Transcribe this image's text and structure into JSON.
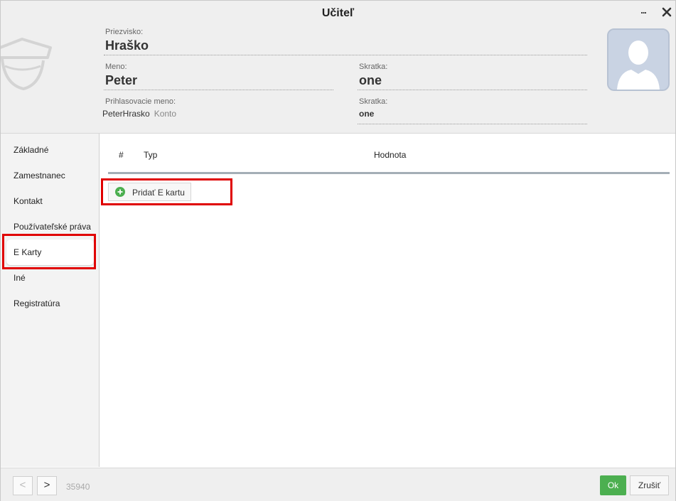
{
  "window": {
    "title": "Učiteľ",
    "more_label": "...",
    "close_label": "Close"
  },
  "header": {
    "surname_label": "Priezvisko:",
    "surname": "Hraško",
    "first_name_label": "Meno:",
    "first_name": "Peter",
    "abbrev_label": "Skratka:",
    "abbrev": "one",
    "login_label": "Prihlasovacie meno:",
    "login": "PeterHrasko",
    "account_link": "Konto",
    "abbrev2_label": "Skratka:",
    "abbrev2": "one"
  },
  "sidebar": {
    "items": [
      {
        "label": "Základné"
      },
      {
        "label": "Zamestnanec"
      },
      {
        "label": "Kontakt"
      },
      {
        "label": "Používateľské práva"
      },
      {
        "label": "E Karty"
      },
      {
        "label": "Iné"
      },
      {
        "label": "Registratúra"
      }
    ],
    "active_index": 4
  },
  "table": {
    "columns": [
      "#",
      "Typ",
      "Hodnota"
    ],
    "rows": []
  },
  "actions": {
    "add_card": "Pridať E kartu"
  },
  "footer": {
    "prev": "<",
    "next": ">",
    "record_id": "35940",
    "ok": "Ok",
    "cancel": "Zrušiť"
  },
  "colors": {
    "accent_green": "#4caf50",
    "highlight_red": "#e00000",
    "header_bg": "#efefef"
  }
}
